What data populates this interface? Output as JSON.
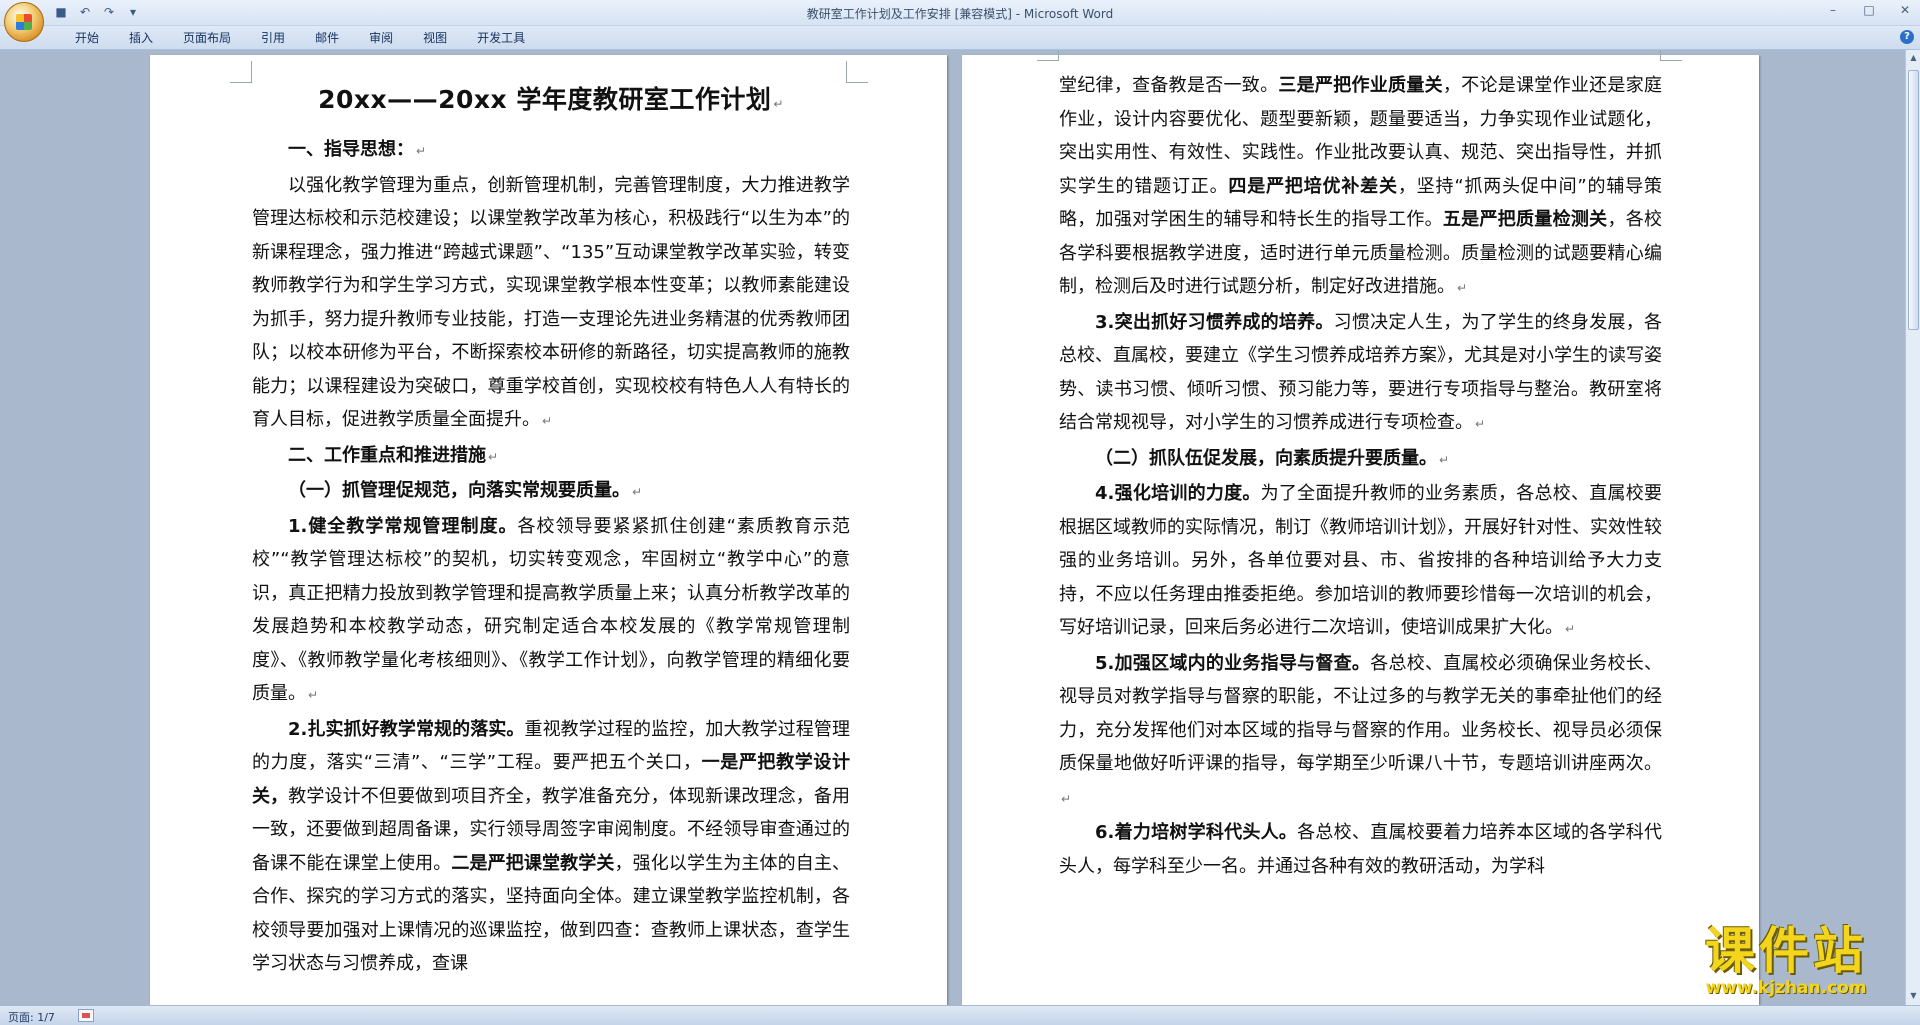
{
  "window": {
    "title": "教研室工作计划及工作安排 [兼容模式] - Microsoft Word",
    "qat_icons": [
      "save-icon",
      "undo-icon",
      "redo-icon",
      "customize-icon"
    ],
    "controls": {
      "minimize": "–",
      "maximize": "□",
      "close": "✕"
    }
  },
  "ribbon": {
    "tabs": [
      "开始",
      "插入",
      "页面布局",
      "引用",
      "邮件",
      "审阅",
      "视图",
      "开发工具"
    ],
    "help": "?"
  },
  "doc": {
    "title": "20xx——20xx 学年度教研室工作计划",
    "left": {
      "h1": "一、指导思想：",
      "p1": "以强化教学管理为重点，创新管理机制，完善管理制度，大力推进教学管理达标校和示范校建设；以课堂教学改革为核心，积极践行“以生为本”的新课程理念，强力推进“跨越式课题”、“135”互动课堂教学改革实验，转变教师教学行为和学生学习方式，实现课堂教学根本性变革；以教师素能建设为抓手，努力提升教师专业技能，打造一支理论先进业务精湛的优秀教师团队；以校本研修为平台，不断探索校本研修的新路径，切实提高教师的施教能力；以课程建设为突破口，尊重学校首创，实现校校有特色人人有特长的育人目标，促进教学质量全面提升。",
      "h2": "二、工作重点和推进措施",
      "h3": "（一）抓管理促规范，向落实常规要质量。",
      "p2_bold": "1.健全教学常规管理制度。",
      "p2": "各校领导要紧紧抓住创建“素质教育示范校”“教学管理达标校”的契机，切实转变观念，牢固树立“教学中心”的意识，真正把精力投放到教学管理和提高教学质量上来；认真分析教学改革的发展趋势和本校教学动态，研究制定适合本校发展的《教学常规管理制度》、《教师教学量化考核细则》、《教学工作计划》，向教学管理的精细化要质量。",
      "p3_bold": "2.扎实抓好教学常规的落实。",
      "p3a": "重视教学过程的监控，加大教学过程管理的力度，落实“三清”、“三学”工程。要严把五个关口，",
      "p3b_bold": "一是严把教学设计关，",
      "p3c": "教学设计不但要做到项目齐全，教学准备充分，体现新课改理念，备用一致，还要做到超周备课，实行领导周签字审阅制度。不经领导审查通过的备课不能在课堂上使用。",
      "p3d_bold": "二是严把课堂教学关",
      "p3e": "，强化以学生为主体的自主、合作、探究的学习方式的落实，坚持面向全体。建立课堂教学监控机制，各校领导要加强对上课情况的巡课监控，做到四查：查教师上课状态，查学生学习状态与习惯养成，查课"
    },
    "right": {
      "p1a": "堂纪律，查备教是否一致。",
      "p1b_bold": "三是严把作业质量关",
      "p1c": "，不论是课堂作业还是家庭作业，设计内容要优化、题型要新颖，题量要适当，力争实现作业试题化，突出实用性、有效性、实践性。作业批改要认真、规范、突出指导性，并抓实学生的错题订正。",
      "p1d_bold": "四是严把培优补差关",
      "p1e": "，坚持“抓两头促中间”的辅导策略，加强对学困生的辅导和特长生的指导工作。",
      "p1f_bold": "五是严把质量检测关",
      "p1g": "，各校各学科要根据教学进度，适时进行单元质量检测。质量检测的试题要精心编制，检测后及时进行试题分析，制定好改进措施。",
      "p2_bold": "3.突出抓好习惯养成的培养。",
      "p2": "习惯决定人生，为了学生的终身发展，各总校、直属校，要建立《学生习惯养成培养方案》，尤其是对小学生的读写姿势、读书习惯、倾听习惯、预习能力等，要进行专项指导与整治。教研室将结合常规视导，对小学生的习惯养成进行专项检查。",
      "h1": "（二）抓队伍促发展，向素质提升要质量。",
      "p3_bold": "4.强化培训的力度。",
      "p3": "为了全面提升教师的业务素质，各总校、直属校要根据区域教师的实际情况，制订《教师培训计划》，开展好针对性、实效性较强的业务培训。另外，各单位要对县、市、省按排的各种培训给予大力支持，不应以任务理由推委拒绝。参加培训的教师要珍惜每一次培训的机会，写好培训记录，回来后务必进行二次培训，使培训成果扩大化。",
      "p4_bold": "5.加强区域内的业务指导与督查。",
      "p4": "各总校、直属校必须确保业务校长、视导员对教学指导与督察的职能，不让过多的与教学无关的事牵扯他们的经力，充分发挥他们对本区域的指导与督察的作用。业务校长、视导员必须保质保量地做好听评课的指导，每学期至少听课八十节，专题培训讲座两次。",
      "p5_bold": "6.着力培树学科代头人。",
      "p5": "各总校、直属校要着力培养本区域的各学科代头人，每学科至少一名。并通过各种有效的教研活动，为学科"
    }
  },
  "status": {
    "page_count": "页面: 1/7"
  },
  "watermark": {
    "main": "课件站",
    "url": "www.kjzhan.com"
  },
  "colors": {
    "workspace": "#a9b8cc",
    "watermark": "#f2d51c"
  }
}
